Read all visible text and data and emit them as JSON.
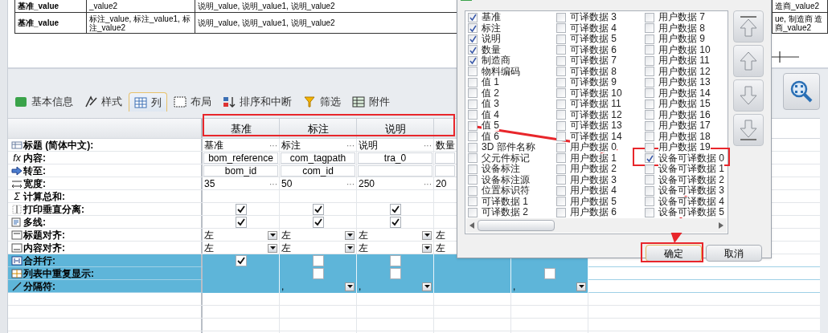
{
  "preview": {
    "rows": [
      {
        "cells": [
          "基准_value",
          "_value2",
          "说明_value, 说明_value1, 说明_value2",
          "造商_value2"
        ]
      },
      {
        "cells": [
          "基准_value",
          "标注_value, 标注_value1, 标注_value2",
          "说明_value, 说明_value1, 说明_value2",
          "ue, 制造商 造商_value2"
        ]
      }
    ]
  },
  "tabs": [
    {
      "label": "基本信息",
      "selected": false
    },
    {
      "label": "样式",
      "selected": false
    },
    {
      "label": "列",
      "selected": true
    },
    {
      "label": "布局",
      "selected": false
    },
    {
      "label": "排序和中断",
      "selected": false
    },
    {
      "label": "筛选",
      "selected": false
    },
    {
      "label": "附件",
      "selected": false
    }
  ],
  "grid": {
    "headers": [
      "基准",
      "标注",
      "说明"
    ],
    "rows": [
      {
        "label": "标题 (简体中文):",
        "highlighted": false,
        "cells": [
          {
            "kind": "text",
            "value": "基准",
            "button": "···"
          },
          {
            "kind": "text",
            "value": "标注",
            "button": "···"
          },
          {
            "kind": "text",
            "value": "说明",
            "button": "···"
          },
          {
            "kind": "text",
            "value": "数量"
          },
          {
            "kind": "empty"
          }
        ]
      },
      {
        "label": "内容:",
        "symbol": "fx",
        "highlighted": false,
        "cells": [
          {
            "kind": "field",
            "value": "bom_reference"
          },
          {
            "kind": "field",
            "value": "com_tagpath"
          },
          {
            "kind": "field",
            "value": "tra_0"
          },
          {
            "kind": "field"
          },
          {
            "kind": "empty"
          }
        ]
      },
      {
        "label": "转至:",
        "highlighted": false,
        "cells": [
          {
            "kind": "field",
            "value": "bom_id"
          },
          {
            "kind": "field",
            "value": "com_id"
          },
          {
            "kind": "field"
          },
          {
            "kind": "field"
          },
          {
            "kind": "empty"
          }
        ]
      },
      {
        "label": "宽度:",
        "highlighted": false,
        "cells": [
          {
            "kind": "text",
            "value": "35",
            "button": "···"
          },
          {
            "kind": "text",
            "value": "50",
            "button": "···"
          },
          {
            "kind": "text",
            "value": "250",
            "button": "···"
          },
          {
            "kind": "text",
            "value": "20"
          },
          {
            "kind": "empty"
          }
        ]
      },
      {
        "label": "计算总和:",
        "symbol": "Σ",
        "highlighted": false,
        "cells": [
          {
            "kind": "empty"
          },
          {
            "kind": "empty"
          },
          {
            "kind": "empty"
          },
          {
            "kind": "empty"
          },
          {
            "kind": "empty"
          }
        ]
      },
      {
        "label": "打印垂直分离:",
        "highlighted": false,
        "cells": [
          {
            "kind": "check",
            "checked": true
          },
          {
            "kind": "check",
            "checked": true
          },
          {
            "kind": "check",
            "checked": true
          },
          {
            "kind": "empty"
          },
          {
            "kind": "empty"
          }
        ]
      },
      {
        "label": "多线:",
        "highlighted": false,
        "cells": [
          {
            "kind": "check",
            "checked": true
          },
          {
            "kind": "check",
            "checked": true
          },
          {
            "kind": "check",
            "checked": true
          },
          {
            "kind": "empty"
          },
          {
            "kind": "empty"
          }
        ]
      },
      {
        "label": "标题对齐:",
        "highlighted": false,
        "cells": [
          {
            "kind": "select",
            "value": "左"
          },
          {
            "kind": "select",
            "value": "左"
          },
          {
            "kind": "select",
            "value": "左"
          },
          {
            "kind": "text",
            "value": "左"
          },
          {
            "kind": "empty"
          }
        ]
      },
      {
        "label": "内容对齐:",
        "highlighted": false,
        "cells": [
          {
            "kind": "select",
            "value": "左"
          },
          {
            "kind": "select",
            "value": "左"
          },
          {
            "kind": "select",
            "value": "左"
          },
          {
            "kind": "text",
            "value": "左"
          },
          {
            "kind": "empty"
          }
        ]
      },
      {
        "label": "合并行:",
        "highlighted": true,
        "cells": [
          {
            "kind": "check",
            "checked": true
          },
          {
            "kind": "check",
            "checked": false
          },
          {
            "kind": "check",
            "checked": false
          },
          {
            "kind": "empty"
          },
          {
            "kind": "empty"
          }
        ]
      },
      {
        "label": "列表中重复显示:",
        "highlighted": true,
        "cells": [
          {
            "kind": "empty"
          },
          {
            "kind": "check",
            "checked": false
          },
          {
            "kind": "check",
            "checked": false
          },
          {
            "kind": "empty"
          },
          {
            "kind": "check",
            "checked": false
          }
        ]
      },
      {
        "label": "分隔符:",
        "highlighted": true,
        "cells": [
          {
            "kind": "empty"
          },
          {
            "kind": "select",
            "value": ","
          },
          {
            "kind": "select",
            "value": ","
          },
          {
            "kind": "empty"
          },
          {
            "kind": "select",
            "value": ","
          }
        ]
      }
    ]
  },
  "dialog": {
    "columns": [
      [
        {
          "label": "基准",
          "checked": true
        },
        {
          "label": "标注",
          "checked": true
        },
        {
          "label": "说明",
          "checked": true
        },
        {
          "label": "数量",
          "checked": true
        },
        {
          "label": "制造商",
          "checked": true
        },
        {
          "label": "物料编码",
          "checked": false
        },
        {
          "label": "值 1",
          "checked": false
        },
        {
          "label": "值 2",
          "checked": false
        },
        {
          "label": "值 3",
          "checked": false
        },
        {
          "label": "值 4",
          "checked": false
        },
        {
          "label": "值 5",
          "checked": false
        },
        {
          "label": "值 6",
          "checked": false
        },
        {
          "label": "3D 部件名称",
          "checked": false
        },
        {
          "label": "父元件标记",
          "checked": false
        },
        {
          "label": "设备标注",
          "checked": false
        },
        {
          "label": "设备标注源",
          "checked": false
        },
        {
          "label": "位置标识符",
          "checked": false
        },
        {
          "label": "可译数据 1",
          "checked": false
        },
        {
          "label": "可译数据 2",
          "checked": false
        }
      ],
      [
        {
          "label": "可译数据 3",
          "checked": false
        },
        {
          "label": "可译数据 4",
          "checked": false
        },
        {
          "label": "可译数据 5",
          "checked": false
        },
        {
          "label": "可译数据 6",
          "checked": false
        },
        {
          "label": "可译数据 7",
          "checked": false
        },
        {
          "label": "可译数据 8",
          "checked": false
        },
        {
          "label": "可译数据 9",
          "checked": false
        },
        {
          "label": "可译数据 10",
          "checked": false
        },
        {
          "label": "可译数据 11",
          "checked": false
        },
        {
          "label": "可译数据 12",
          "checked": false
        },
        {
          "label": "可译数据 13",
          "checked": false
        },
        {
          "label": "可译数据 14",
          "checked": false
        },
        {
          "label": "用户数据 0",
          "checked": false
        },
        {
          "label": "用户数据 1",
          "checked": false
        },
        {
          "label": "用户数据 2",
          "checked": false
        },
        {
          "label": "用户数据 3",
          "checked": false
        },
        {
          "label": "用户数据 4",
          "checked": false
        },
        {
          "label": "用户数据 5",
          "checked": false
        },
        {
          "label": "用户数据 6",
          "checked": false
        }
      ],
      [
        {
          "label": "用户数据 7",
          "checked": false
        },
        {
          "label": "用户数据 8",
          "checked": false
        },
        {
          "label": "用户数据 9",
          "checked": false
        },
        {
          "label": "用户数据 10",
          "checked": false
        },
        {
          "label": "用户数据 11",
          "checked": false
        },
        {
          "label": "用户数据 12",
          "checked": false
        },
        {
          "label": "用户数据 13",
          "checked": false
        },
        {
          "label": "用户数据 14",
          "checked": false
        },
        {
          "label": "用户数据 15",
          "checked": false
        },
        {
          "label": "用户数据 16",
          "checked": false
        },
        {
          "label": "用户数据 17",
          "checked": false
        },
        {
          "label": "用户数据 18",
          "checked": false
        },
        {
          "label": "用户数据 19",
          "checked": false
        },
        {
          "label": "设备可译数据 0",
          "checked": true
        },
        {
          "label": "设备可译数据 1",
          "checked": false
        },
        {
          "label": "设备可译数据 2",
          "checked": false
        },
        {
          "label": "设备可译数据 3",
          "checked": false
        },
        {
          "label": "设备可译数据 4",
          "checked": false
        },
        {
          "label": "设备可译数据 5",
          "checked": false
        }
      ]
    ],
    "buttons": [
      "确定",
      "取消"
    ]
  }
}
